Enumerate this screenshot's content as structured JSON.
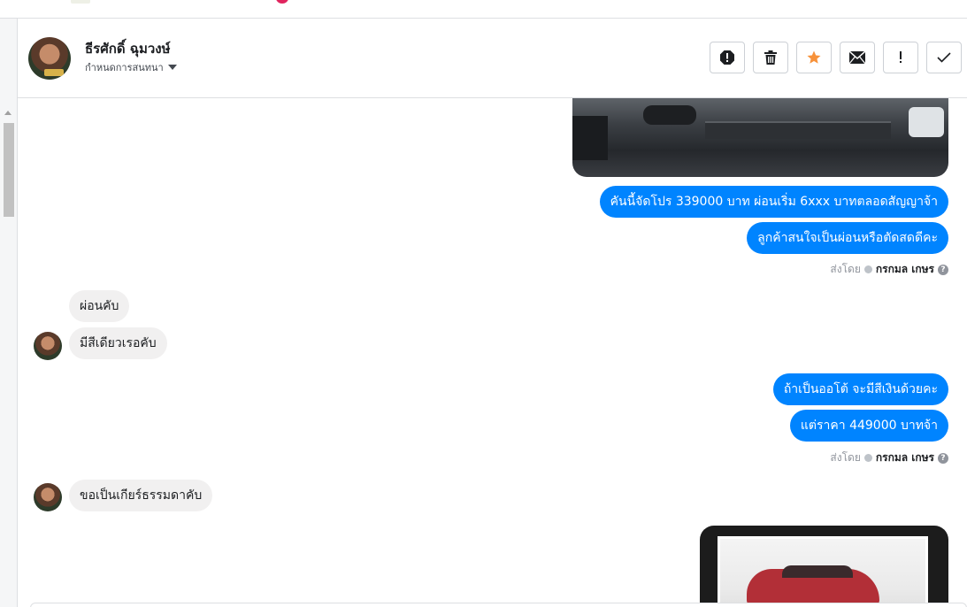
{
  "header": {
    "contact_name": "ธีรศักดิ์ ฉุมวงษ์",
    "label_dropdown": "กำหนดการสนทนา",
    "actions": [
      {
        "name": "mark-spam-icon"
      },
      {
        "name": "trash-icon"
      },
      {
        "name": "star-icon"
      },
      {
        "name": "envelope-icon"
      },
      {
        "name": "exclamation-icon"
      },
      {
        "name": "check-icon"
      }
    ]
  },
  "messages": {
    "out1": "คันนี้จัดโปร 339000 บาท ผ่อนเริ่ม 6xxx บาทตลอดสัญญาจ้า",
    "out2": "ลูกค้าสนใจเป็นผ่อนหรือตัดสดดีคะ",
    "sent_by_label": "ส่งโดย",
    "sent_by_name": "กรกมล เกษร",
    "in1": "ผ่อนคับ",
    "in2": "มีสีเดียวเรอคับ",
    "out3": "ถ้าเป็นออโต้ จะมีสีเงินด้วยคะ",
    "out4": "แต่ราคา 449000 บาทจ้า",
    "in3": "ขอเป็นเกียร์ธรรมดาคับ"
  },
  "colors": {
    "outgoing_bubble": "#0084ff",
    "incoming_bubble": "#f1f0f0",
    "star": "#f7923b"
  }
}
